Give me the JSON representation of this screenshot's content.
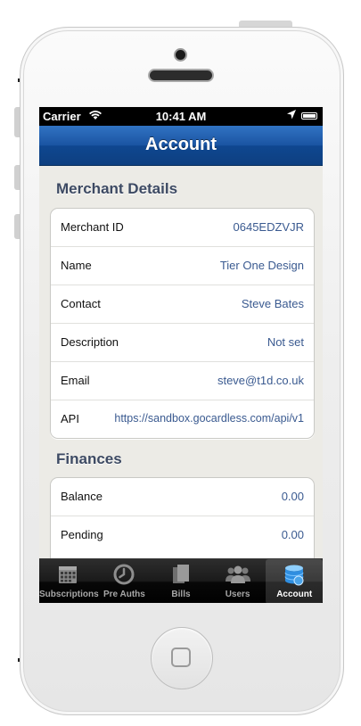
{
  "status_bar": {
    "carrier": "Carrier",
    "time": "10:41 AM"
  },
  "nav": {
    "title": "Account"
  },
  "merchant_details": {
    "title": "Merchant Details",
    "rows": [
      {
        "label": "Merchant ID",
        "value": "0645EDZVJR"
      },
      {
        "label": "Name",
        "value": "Tier One Design"
      },
      {
        "label": "Contact",
        "value": "Steve Bates"
      },
      {
        "label": "Description",
        "value": "Not set"
      },
      {
        "label": "Email",
        "value": "steve@t1d.co.uk"
      },
      {
        "label": "API",
        "value": "https://sandbox.gocardless.com/api/v1"
      }
    ]
  },
  "finances": {
    "title": "Finances",
    "rows": [
      {
        "label": "Balance",
        "value": "0.00"
      },
      {
        "label": "Pending",
        "value": "0.00"
      }
    ]
  },
  "tabs": [
    {
      "label": "Subscriptions",
      "icon": "calendar-icon"
    },
    {
      "label": "Pre Auths",
      "icon": "clock-icon"
    },
    {
      "label": "Bills",
      "icon": "bills-icon"
    },
    {
      "label": "Users",
      "icon": "users-icon"
    },
    {
      "label": "Account",
      "icon": "account-icon",
      "active": true
    }
  ],
  "colors": {
    "nav_blue": "#1a54a2",
    "value_text": "#3a5a90",
    "section_title": "#3d4a63",
    "active_tab_icon": "#4aa3e8"
  }
}
